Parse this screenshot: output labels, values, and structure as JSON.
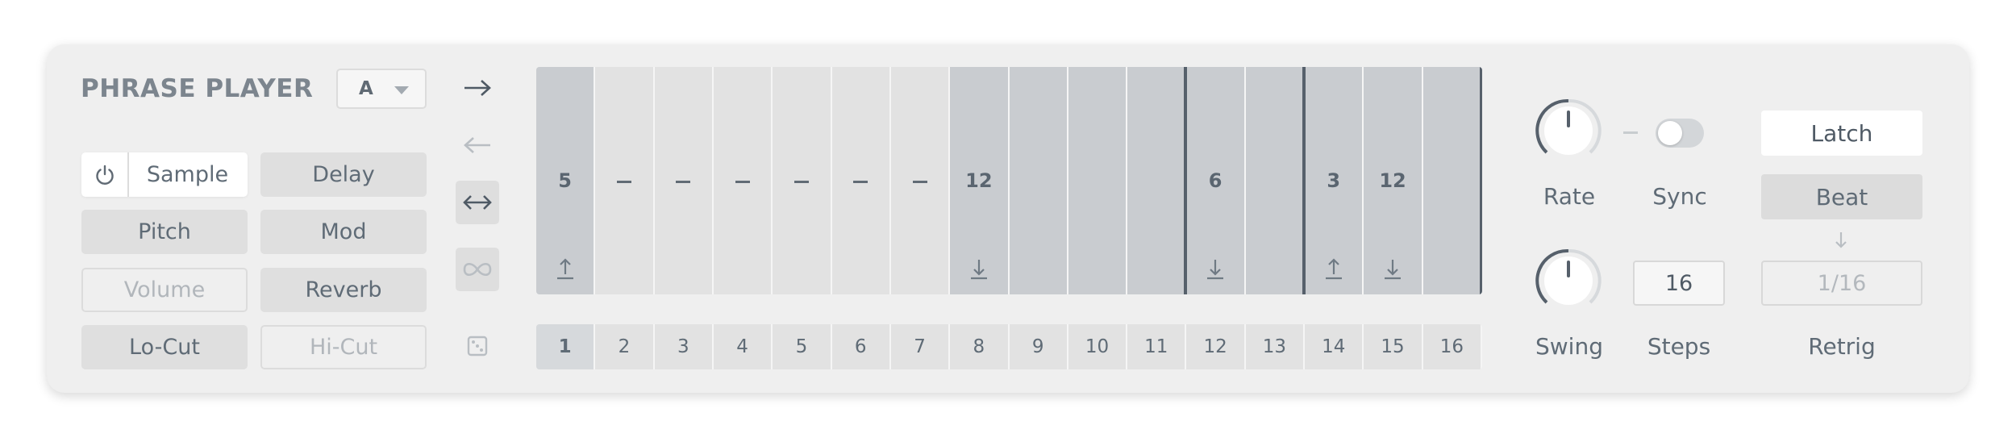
{
  "header": {
    "title": "PHRASE PLAYER",
    "preset_value": "A"
  },
  "targets": {
    "sample": "Sample",
    "delay": "Delay",
    "pitch": "Pitch",
    "mod": "Mod",
    "volume": "Volume",
    "reverb": "Reverb",
    "locut": "Lo-Cut",
    "hicut": "Hi-Cut"
  },
  "sequencer": {
    "steps": [
      {
        "value": "5",
        "type": "value",
        "icon": "up"
      },
      {
        "value": "",
        "type": "dash",
        "icon": ""
      },
      {
        "value": "",
        "type": "dash",
        "icon": ""
      },
      {
        "value": "",
        "type": "dash",
        "icon": ""
      },
      {
        "value": "",
        "type": "dash",
        "icon": ""
      },
      {
        "value": "",
        "type": "dash",
        "icon": ""
      },
      {
        "value": "",
        "type": "dash",
        "icon": ""
      },
      {
        "value": "12",
        "type": "value",
        "icon": "down"
      },
      {
        "value": "",
        "type": "empty",
        "icon": ""
      },
      {
        "value": "",
        "type": "empty",
        "icon": ""
      },
      {
        "value": "",
        "type": "empty",
        "icon": ""
      },
      {
        "value": "6",
        "type": "value",
        "icon": "down"
      },
      {
        "value": "",
        "type": "empty",
        "icon": ""
      },
      {
        "value": "3",
        "type": "value",
        "icon": "up"
      },
      {
        "value": "12",
        "type": "value",
        "icon": "down"
      },
      {
        "value": "",
        "type": "empty",
        "icon": ""
      }
    ],
    "step_numbers": [
      "1",
      "2",
      "3",
      "4",
      "5",
      "6",
      "7",
      "8",
      "9",
      "10",
      "11",
      "12",
      "13",
      "14",
      "15",
      "16"
    ],
    "current_step": 1
  },
  "controls": {
    "rate_label": "Rate",
    "sync_label": "Sync",
    "swing_label": "Swing",
    "steps_label": "Steps",
    "steps_value": "16",
    "latch": "Latch",
    "beat": "Beat",
    "retrig_value": "1/16",
    "retrig_label": "Retrig",
    "sync_on": false
  },
  "colors": {
    "panel": "#efefef",
    "accent": "#56606b"
  }
}
